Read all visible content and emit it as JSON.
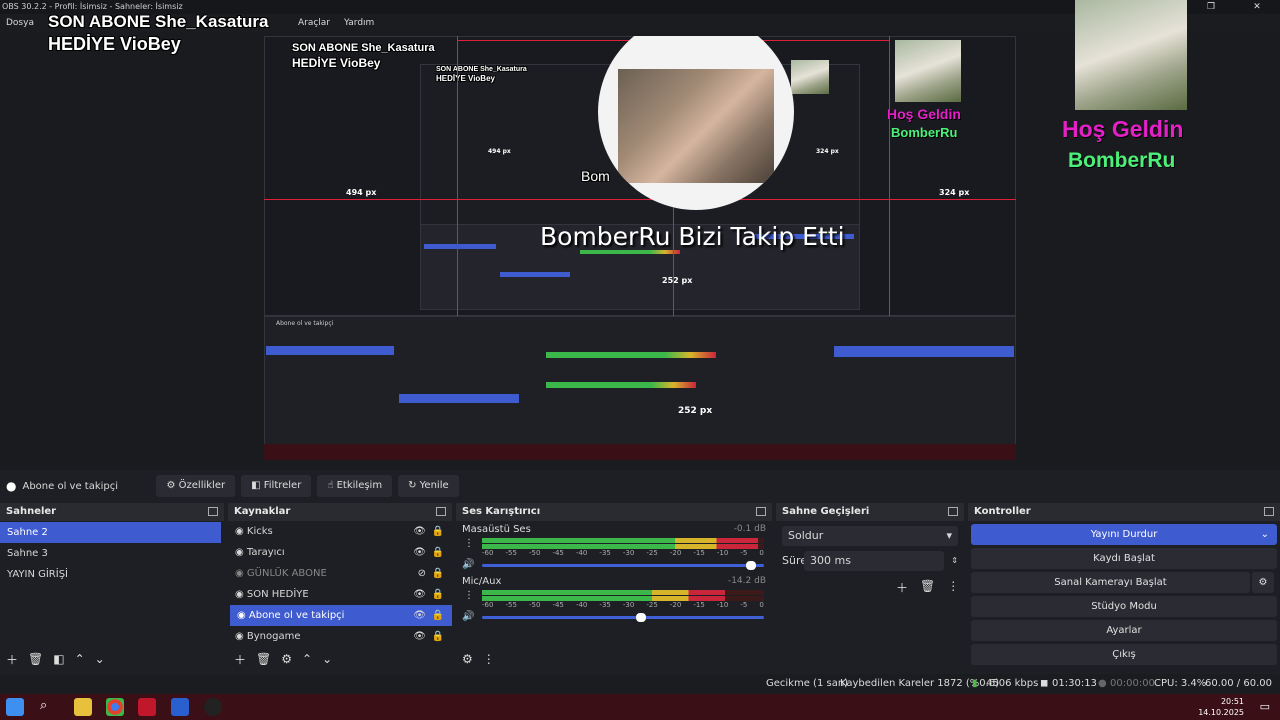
{
  "window": {
    "title": "OBS 30.2.2 - Profil: İsimsiz - Sahneler: İsimsiz"
  },
  "menu": [
    "Dosya",
    "Araçlar",
    "Yardım"
  ],
  "overlay": {
    "son_abone": "SON ABONE She_Kasatura",
    "hediye": "HEDİYE VioBey",
    "hos_geldin": "Hoş Geldin",
    "hos_name": "BomberRu",
    "follow_alert": "BomberRu Bizi Takip Etti",
    "bubble_partial": "Bom",
    "measure_left": "494 px",
    "measure_right": "324 px",
    "measure_bottom": "252 px"
  },
  "colors": {
    "accent": "#3f5bd0",
    "hos_pink": "#e620c8",
    "hos_green": "#4cf078",
    "guide_red": "#e0203a"
  },
  "source_toolbar": {
    "selected_source": "Abone ol ve takipçi",
    "buttons": [
      "Özellikler",
      "Filtreler",
      "Etkileşim",
      "Yenile"
    ]
  },
  "scenes": {
    "title": "Sahneler",
    "items": [
      "Sahne 2",
      "Sahne 3",
      "YAYIN GİRİŞİ"
    ],
    "selected": 0
  },
  "sources": {
    "title": "Kaynaklar",
    "items": [
      "Kicks",
      "Tarayıcı",
      "GÜNLÜK ABONE",
      "SON HEDİYE",
      "Abone ol ve takipçi",
      "Bynogame"
    ]
  },
  "mixer": {
    "title": "Ses Karıştırıcı",
    "channels": [
      {
        "name": "Masaüstü Ses",
        "db": "-0.1 dB",
        "level": 0.98,
        "volume": 0.97
      },
      {
        "name": "Mic/Aux",
        "db": "-14.2 dB",
        "level": 0.86,
        "volume": 0.58
      }
    ],
    "ticks": [
      "-60",
      "-55",
      "-50",
      "-45",
      "-40",
      "-35",
      "-30",
      "-25",
      "-20",
      "-15",
      "-10",
      "-5",
      "0"
    ]
  },
  "transitions": {
    "title": "Sahne Geçişleri",
    "selected": "Soldur",
    "duration_label": "Süre",
    "duration_value": "300 ms"
  },
  "controls": {
    "title": "Kontroller",
    "buttons": [
      "Yayını Durdur",
      "Kaydı Başlat",
      "Sanal Kamerayı Başlat",
      "Stüdyo Modu",
      "Ayarlar",
      "Çıkış"
    ]
  },
  "status": {
    "delay": "Gecikme (1 san)",
    "dropped": "Kaybedilen Kareler 1872 (%0.6)",
    "bitrate": "4506 kbps",
    "stream_time": "01:30:13",
    "rec_time": "00:00:00",
    "cpu": "CPU: 3.4%",
    "fps": "60.00 / 60.00 FPS"
  },
  "taskbar": {
    "time": "20:51",
    "date": "14.10.2025"
  }
}
